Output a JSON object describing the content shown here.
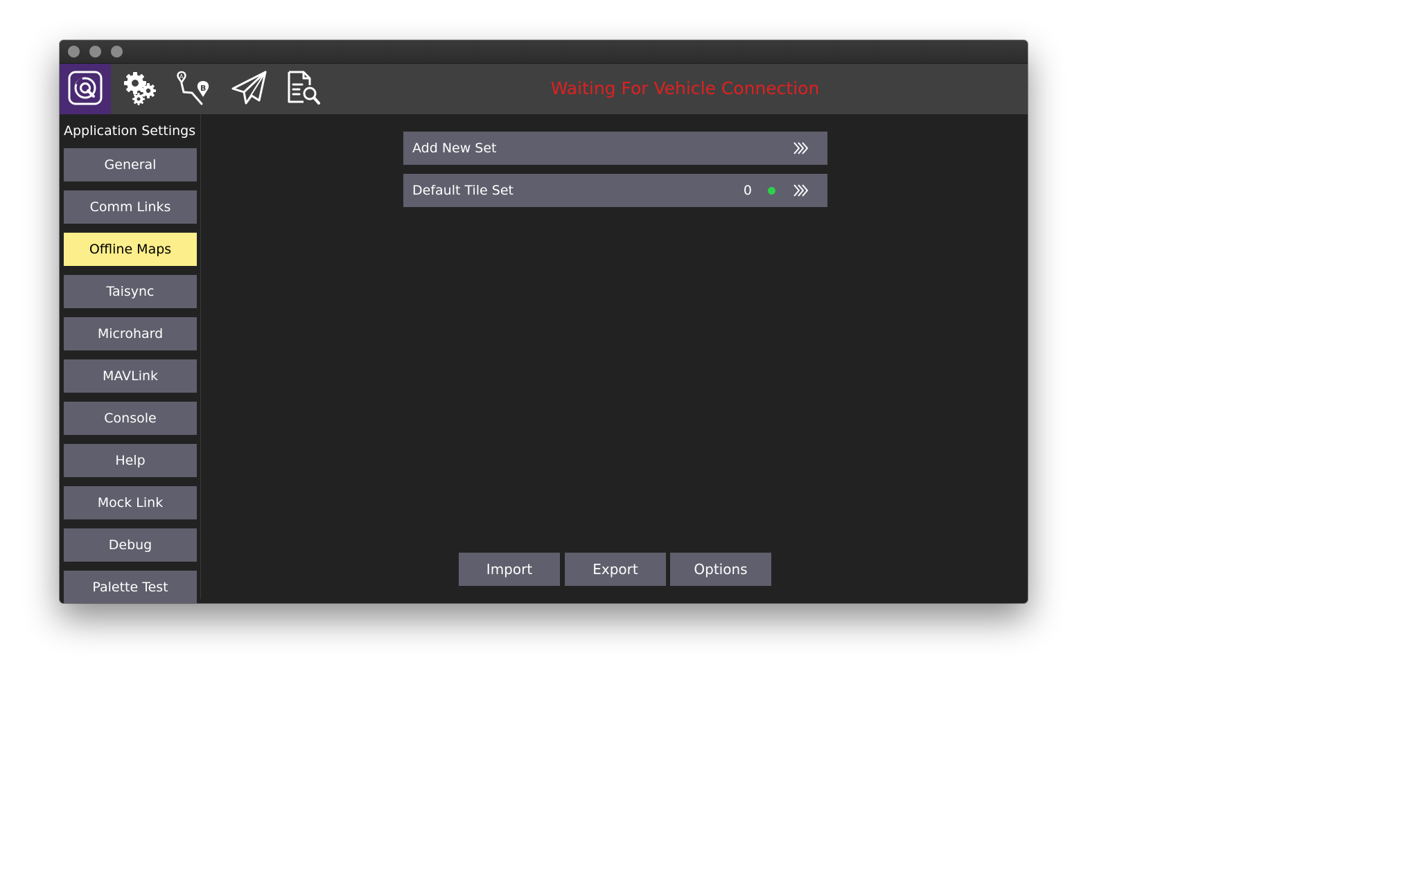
{
  "window": {
    "traffic_lights": [
      "close",
      "minimize",
      "zoom"
    ]
  },
  "toolbar": {
    "items": [
      {
        "name": "qgc-logo-icon",
        "selected": true
      },
      {
        "name": "vehicle-setup-gears-icon"
      },
      {
        "name": "plan-view-route-icon"
      },
      {
        "name": "fly-view-paper-plane-icon"
      },
      {
        "name": "analyze-document-search-icon"
      }
    ],
    "status_text": "Waiting For Vehicle Connection",
    "status_color": "#e02020",
    "home_bg": "#4a2a72"
  },
  "sidebar": {
    "heading": "Application Settings",
    "items": [
      {
        "label": "General"
      },
      {
        "label": "Comm Links"
      },
      {
        "label": "Offline Maps",
        "active": true
      },
      {
        "label": "Taisync"
      },
      {
        "label": "Microhard"
      },
      {
        "label": "MAVLink"
      },
      {
        "label": "Console"
      },
      {
        "label": "Help"
      },
      {
        "label": "Mock Link"
      },
      {
        "label": "Debug"
      },
      {
        "label": "Palette Test"
      }
    ]
  },
  "tile_sets": {
    "add_new": {
      "label": "Add New Set",
      "icon": "triple-chevron-icon"
    },
    "sets": [
      {
        "label": "Default Tile Set",
        "count": "0",
        "status_color": "#2fd04a",
        "icon": "triple-chevron-icon"
      }
    ]
  },
  "actions": {
    "import_label": "Import",
    "export_label": "Export",
    "options_label": "Options"
  },
  "colors": {
    "background": "#222222",
    "button": "#5f5f6d",
    "active_button": "#fcee8a",
    "toolbar": "#404040"
  }
}
